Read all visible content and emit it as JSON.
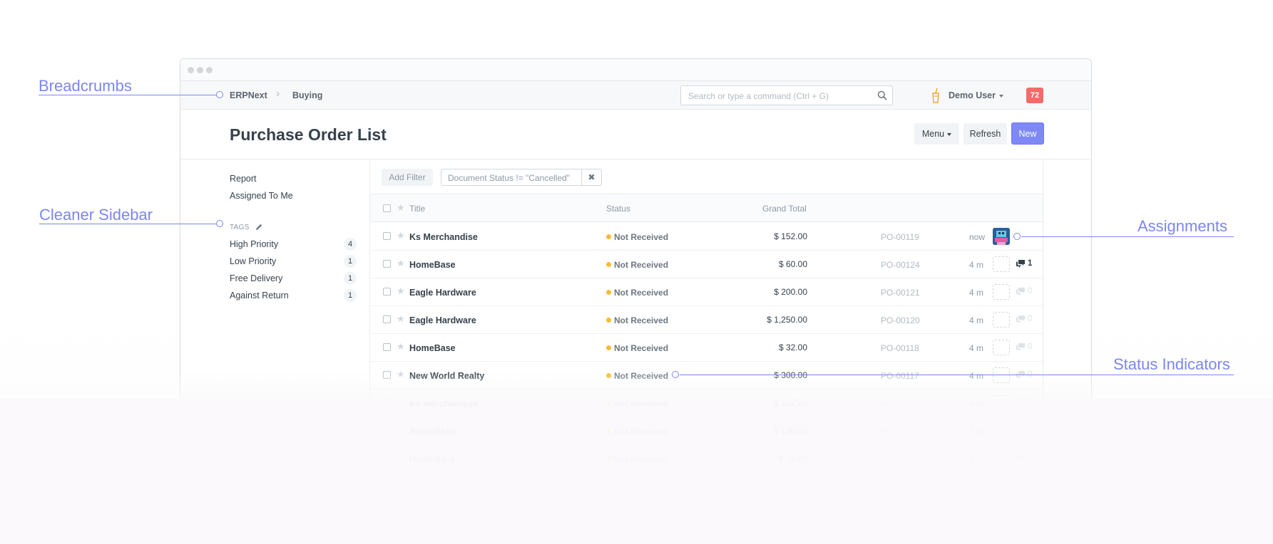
{
  "navbar": {
    "breadcrumbs": [
      "ERPNext",
      "Buying"
    ],
    "search_placeholder": "Search or type a command (Ctrl + G)",
    "user_label": "Demo User",
    "notification_count": "72"
  },
  "page": {
    "title": "Purchase Order List",
    "buttons": {
      "menu": "Menu",
      "refresh": "Refresh",
      "new": "New"
    }
  },
  "sidebar": {
    "links": [
      "Report",
      "Assigned To Me"
    ],
    "tags_heading": "TAGS",
    "tags": [
      {
        "label": "High Priority",
        "count": "4"
      },
      {
        "label": "Low Priority",
        "count": "1"
      },
      {
        "label": "Free Delivery",
        "count": "1"
      },
      {
        "label": "Against Return",
        "count": "1"
      }
    ]
  },
  "filters": {
    "add_label": "Add Filter",
    "active": "Document Status != \"Cancelled\""
  },
  "list": {
    "columns": {
      "title": "Title",
      "status": "Status",
      "total": "Grand Total"
    },
    "rows": [
      {
        "title": "Ks Merchandise",
        "status": "Not Received",
        "total": "$ 152.00",
        "id": "PO-00119",
        "time": "now",
        "assigned": true,
        "comments": ""
      },
      {
        "title": "HomeBase",
        "status": "Not Received",
        "total": "$ 60.00",
        "id": "PO-00124",
        "time": "4 m",
        "assigned": false,
        "comments": "1"
      },
      {
        "title": "Eagle Hardware",
        "status": "Not Received",
        "total": "$ 200.00",
        "id": "PO-00121",
        "time": "4 m",
        "assigned": false,
        "comments": "0"
      },
      {
        "title": "Eagle Hardware",
        "status": "Not Received",
        "total": "$ 1,250.00",
        "id": "PO-00120",
        "time": "4 m",
        "assigned": false,
        "comments": "0"
      },
      {
        "title": "HomeBase",
        "status": "Not Received",
        "total": "$ 32.00",
        "id": "PO-00118",
        "time": "4 m",
        "assigned": false,
        "comments": "0"
      },
      {
        "title": "New World Realty",
        "status": "Not Received",
        "total": "$ 300.00",
        "id": "PO-00117",
        "time": "4 m",
        "assigned": false,
        "comments": "0"
      },
      {
        "title": "Ks Merchandise",
        "status": "Not Received",
        "total": "$ 152.00",
        "id": "PO-00116",
        "time": "4 m",
        "assigned": false,
        "comments": "0"
      },
      {
        "title": "HomeBase",
        "status": "Not Received",
        "total": "$ 150.00",
        "id": "PO-00115",
        "time": "4 m",
        "assigned": false,
        "comments": "0"
      },
      {
        "title": "HomeBase",
        "status": "Not Received",
        "total": "$ 16.00",
        "id": "PO-00114",
        "time": "4 m",
        "assigned": false,
        "comments": "0"
      }
    ]
  },
  "annotations": {
    "breadcrumbs": "Breadcrumbs",
    "sidebar": "Cleaner Sidebar",
    "assignments": "Assignments",
    "status": "Status Indicators"
  },
  "colors": {
    "accent": "#7b86f3",
    "primary_button": "#7e89f6",
    "status_not_received": "#fdbb2d",
    "notification": "#f36b6b"
  }
}
